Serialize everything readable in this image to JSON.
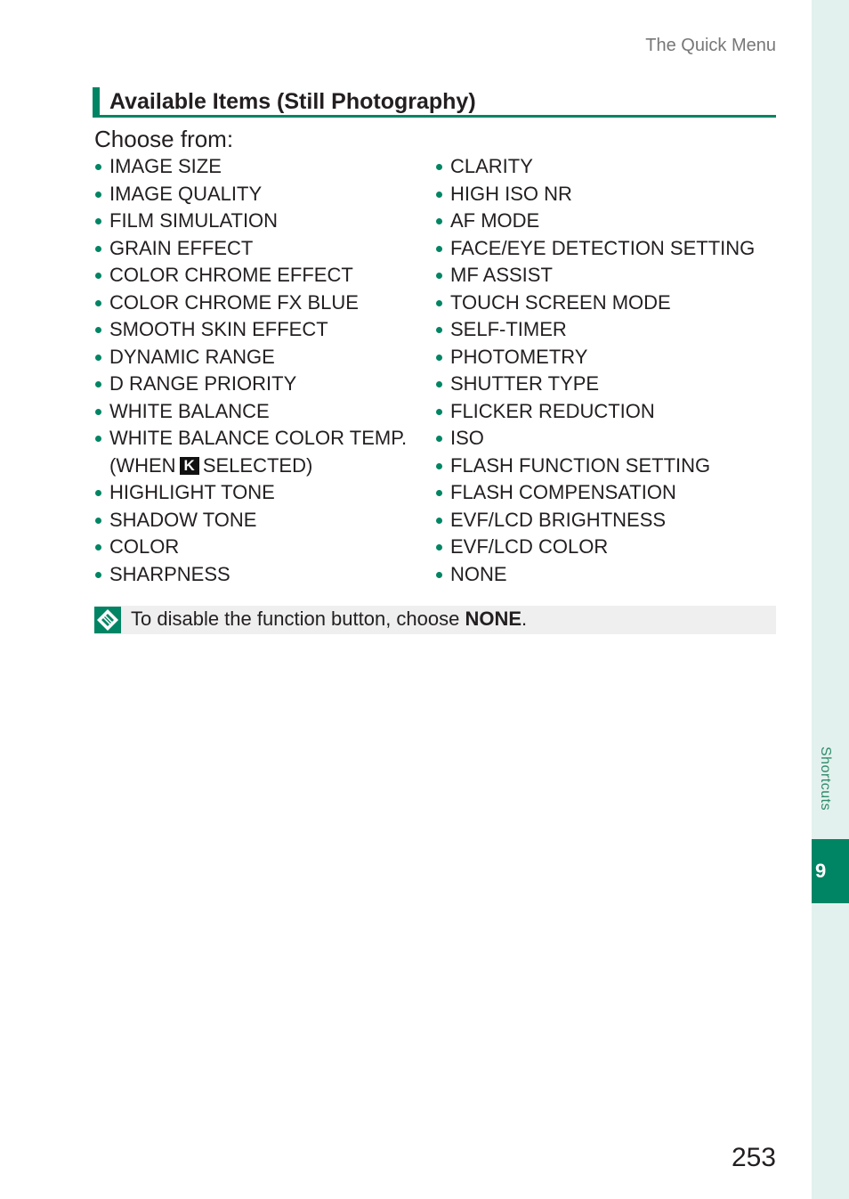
{
  "header": {
    "title": "The Quick Menu"
  },
  "section": {
    "heading": "Available Items (Still Photography)",
    "intro": "Choose from:"
  },
  "left_items": [
    "IMAGE SIZE",
    "IMAGE QUALITY",
    "FILM SIMULATION",
    "GRAIN EFFECT",
    "COLOR CHROME EFFECT",
    "COLOR CHROME FX BLUE",
    "SMOOTH SKIN EFFECT",
    "DYNAMIC RANGE",
    "D RANGE PRIORITY",
    "WHITE BALANCE"
  ],
  "wb_temp_item": {
    "line1": "WHITE BALANCE COLOR TEMP.",
    "line2_pre": "(WHEN",
    "icon_label": "K",
    "line2_post": "SELECTED)"
  },
  "left_items_after": [
    "HIGHLIGHT TONE",
    "SHADOW TONE",
    "COLOR",
    "SHARPNESS"
  ],
  "right_items": [
    "CLARITY",
    "HIGH ISO NR",
    "AF MODE",
    "FACE/EYE DETECTION SETTING",
    "MF ASSIST",
    "TOUCH SCREEN MODE",
    "SELF-TIMER",
    "PHOTOMETRY",
    "SHUTTER TYPE",
    "FLICKER REDUCTION",
    "ISO",
    "FLASH FUNCTION SETTING",
    "FLASH COMPENSATION",
    "EVF/LCD BRIGHTNESS",
    "EVF/LCD COLOR",
    "NONE"
  ],
  "note": {
    "icon": "note-icon",
    "text": "To disable the function button, choose ",
    "bold": "NONE",
    "suffix": "."
  },
  "side": {
    "label": "Shortcuts",
    "chapter": "9"
  },
  "page_number": "253",
  "colors": {
    "accent": "#008564",
    "side_strip": "#e3f1ee",
    "note_bg": "#efefef"
  }
}
